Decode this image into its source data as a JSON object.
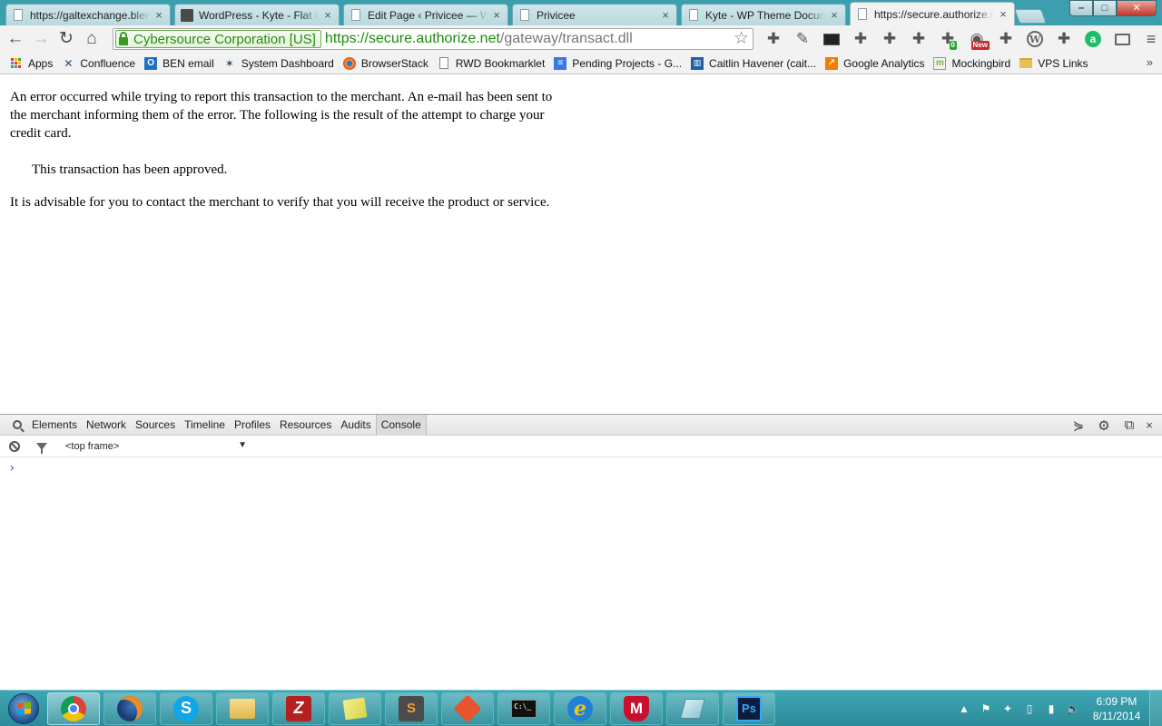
{
  "browser": {
    "tabs": [
      {
        "title": "https://galtexchange.blender",
        "favicon": "document-icon",
        "active": false
      },
      {
        "title": "WordPress - Kyte - Flat Clean",
        "favicon": "wordpress-theme-icon",
        "active": false
      },
      {
        "title": "Edit Page ‹ Privicee — WordPress",
        "favicon": "document-icon",
        "active": false
      },
      {
        "title": "Privicee",
        "favicon": "document-icon",
        "active": false
      },
      {
        "title": "Kyte - WP Theme Documentation",
        "favicon": "document-icon",
        "active": false
      },
      {
        "title": "https://secure.authorize.net",
        "favicon": "document-icon",
        "active": true
      }
    ],
    "tab_close_glyph": "×",
    "window_controls": {
      "minimize": "‒",
      "maximize": "□",
      "close": "✕"
    }
  },
  "toolbar": {
    "back": "←",
    "forward": "→",
    "reload": "↻",
    "home": "⌂",
    "ev_cert_label": "Cybersource Corporation [US]",
    "url_origin": "https://secure.authorize.net",
    "url_path": "/gateway/transact.dll",
    "bookmark_star": "☆",
    "extension_badges": {
      "counter": "0",
      "new": "New"
    },
    "menu_glyph": "≡"
  },
  "bookmarks": [
    {
      "label": "Apps",
      "icon": "apps-grid-icon"
    },
    {
      "label": "Confluence",
      "icon": "confluence-icon"
    },
    {
      "label": "BEN email",
      "icon": "outlook-icon"
    },
    {
      "label": "System Dashboard",
      "icon": "jira-icon"
    },
    {
      "label": "BrowserStack",
      "icon": "browserstack-icon"
    },
    {
      "label": "RWD Bookmarklet",
      "icon": "document-icon"
    },
    {
      "label": "Pending Projects - G...",
      "icon": "google-docs-icon"
    },
    {
      "label": "Caitlin Havener (cait...",
      "icon": "trello-icon"
    },
    {
      "label": "Google Analytics",
      "icon": "google-analytics-icon"
    },
    {
      "label": "Mockingbird",
      "icon": "mockingbird-icon"
    },
    {
      "label": "VPS Links",
      "icon": "folder-icon"
    }
  ],
  "bookmarks_overflow": "»",
  "page": {
    "error_paragraph": "An error occurred while trying to report this transaction to the merchant. An e-mail has been sent to the merchant informing them of the error. The following is the result of the attempt to charge your credit card.",
    "approved_text": "This transaction has been approved.",
    "advice_text": "It is advisable for you to contact the merchant to verify that you will receive the product or service."
  },
  "devtools": {
    "tabs": [
      "Elements",
      "Network",
      "Sources",
      "Timeline",
      "Profiles",
      "Resources",
      "Audits",
      "Console"
    ],
    "active_tab": "Console",
    "frame_selector": "<top frame>",
    "frame_arrow": "▼",
    "prompt": "›",
    "right_icons": {
      "drawer": "⋟",
      "settings": "⚙",
      "dock": "⧉",
      "close": "×"
    }
  },
  "taskbar": {
    "apps": [
      {
        "name": "chrome",
        "active": true
      },
      {
        "name": "firefox",
        "active": false
      },
      {
        "name": "skype",
        "active": false
      },
      {
        "name": "file-explorer",
        "active": false
      },
      {
        "name": "filezilla",
        "active": false
      },
      {
        "name": "sticky-notes",
        "active": false
      },
      {
        "name": "sublime-text",
        "active": false
      },
      {
        "name": "git",
        "active": false
      },
      {
        "name": "command-prompt",
        "active": false
      },
      {
        "name": "internet-explorer",
        "active": false
      },
      {
        "name": "mcafee",
        "active": false
      },
      {
        "name": "ipad-app",
        "active": false
      },
      {
        "name": "photoshop",
        "active": false
      }
    ],
    "app_glyphs": {
      "skype": "S",
      "filezilla": "Z",
      "sublime": "S",
      "cmd": "C:\\_",
      "ie": "e",
      "mcafee": "M",
      "photoshop": "Ps"
    },
    "tray": {
      "show_hidden": "▲",
      "flag": "⚑",
      "network": "▮",
      "volume": "🔈"
    },
    "clock_time": "6:09 PM",
    "clock_date": "8/11/2014"
  }
}
